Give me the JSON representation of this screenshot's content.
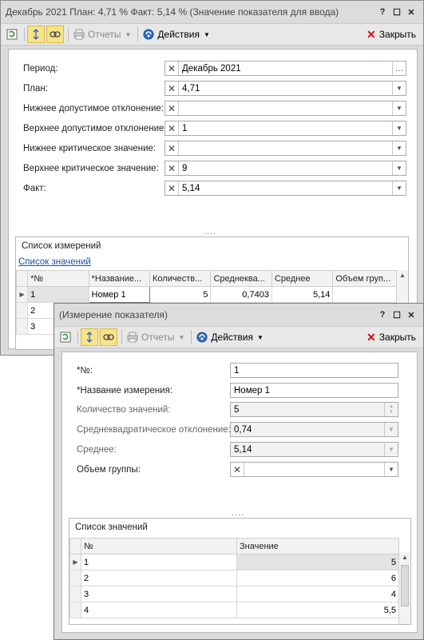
{
  "window1": {
    "title": "Декабрь 2021  План: 4,71 %  Факт: 5,14 % (Значение показателя для ввода)",
    "controls": [
      "?",
      "☐",
      "✕"
    ],
    "toolbar": {
      "reports": "Отчеты",
      "actions": "Действия",
      "close": "Закрыть"
    },
    "fields": [
      {
        "label": "Период:",
        "value": "Декабрь 2021",
        "button": "…"
      },
      {
        "label": "План:",
        "value": "4,71"
      },
      {
        "label": "Нижнее допустимое отклонение:",
        "value": ""
      },
      {
        "label": "Верхнее допустимое отклонение:",
        "value": "1"
      },
      {
        "label": "Нижнее критическое значение:",
        "value": ""
      },
      {
        "label": "Верхнее критическое значение:",
        "value": "9"
      },
      {
        "label": "Факт:",
        "value": "5,14"
      }
    ],
    "grip": "....",
    "group_title": "Список измерений",
    "link": "Список значений",
    "columns": [
      "*№",
      "*Название...",
      "Количеств...",
      "Среднеква...",
      "Среднее",
      "Объем груп..."
    ],
    "rows": [
      [
        "1",
        "Номер 1",
        "5",
        "0,7403",
        "5,14",
        ""
      ],
      [
        "2",
        "",
        "",
        "",
        "",
        ""
      ],
      [
        "3",
        "",
        "",
        "",
        "",
        ""
      ]
    ]
  },
  "window2": {
    "title": "(Измерение показателя)",
    "controls": [
      "?",
      "☐",
      "✕"
    ],
    "toolbar": {
      "reports": "Отчеты",
      "actions": "Действия",
      "close": "Закрыть"
    },
    "fields": [
      {
        "label": "*№:",
        "value": "1"
      },
      {
        "label": "*Название измерения:",
        "value": "Номер 1"
      },
      {
        "label": "Количество значений:",
        "value": "5"
      },
      {
        "label": "Среднеквадратическое отклонение:",
        "value": "0,74"
      },
      {
        "label": "Среднее:",
        "value": "5,14"
      },
      {
        "label": "Объем группы:",
        "value": ""
      }
    ],
    "grip": "....",
    "group_title": "Список значений",
    "columns": [
      "№",
      "Значение"
    ],
    "rows": [
      [
        "1",
        "5"
      ],
      [
        "2",
        "6"
      ],
      [
        "3",
        "4"
      ],
      [
        "4",
        "5,5"
      ]
    ]
  },
  "colors": {
    "highlight": "#f7e48a",
    "close_icon": "#d01010",
    "link": "#1f4fa8"
  }
}
